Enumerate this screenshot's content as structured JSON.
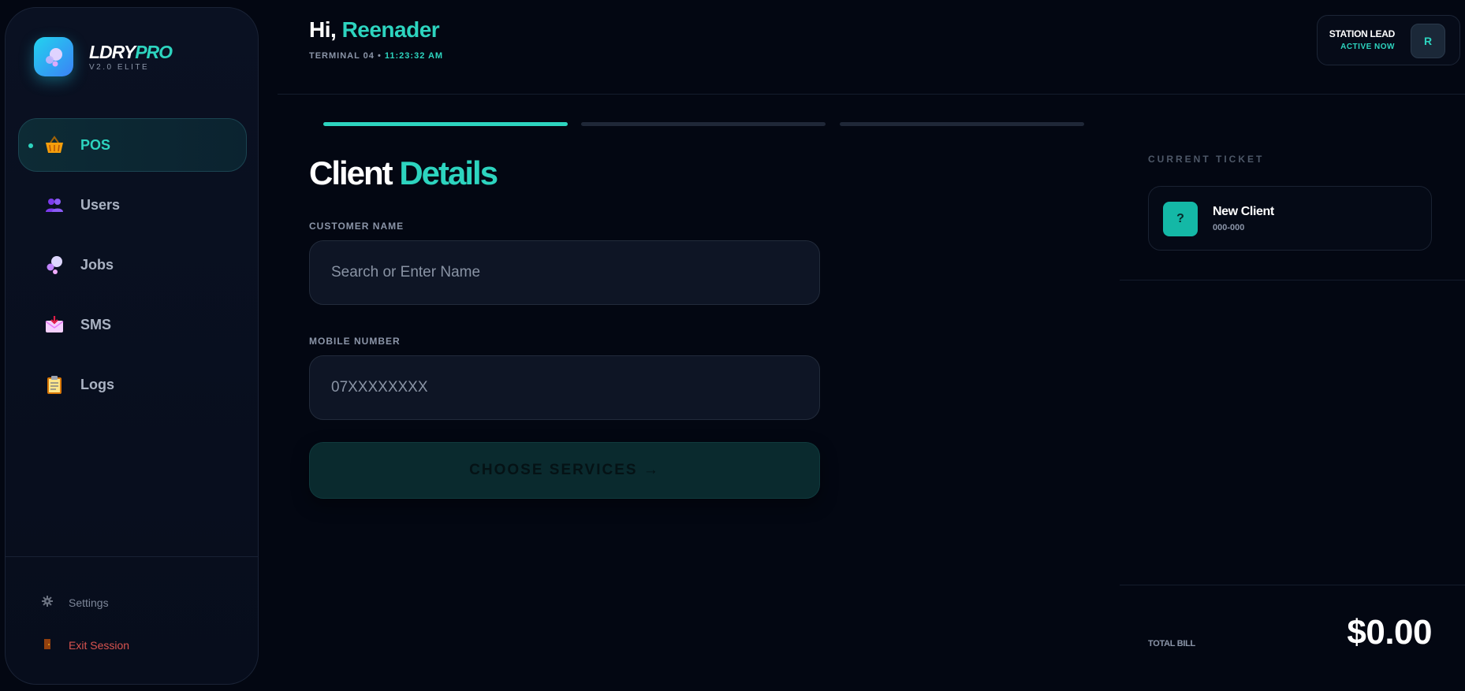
{
  "app": {
    "name_main": "LDRY",
    "name_accent": "PRO",
    "version": "V2.0 ELITE"
  },
  "sidebar": {
    "items": [
      {
        "label": "POS",
        "icon": "basket-icon",
        "active": true
      },
      {
        "label": "Users",
        "icon": "users-icon"
      },
      {
        "label": "Jobs",
        "icon": "bubbles-icon"
      },
      {
        "label": "SMS",
        "icon": "envelope-icon"
      },
      {
        "label": "Logs",
        "icon": "clipboard-icon"
      }
    ],
    "settings_label": "Settings",
    "exit_label": "Exit Session"
  },
  "header": {
    "greeting": "Hi,",
    "user_name": "Reenader",
    "terminal": "TERMINAL 04 •",
    "time": "11:23:32 AM",
    "role": "STATION LEAD",
    "status": "ACTIVE NOW",
    "avatar_initial": "R"
  },
  "steps": {
    "total": 3,
    "completed": 1
  },
  "form": {
    "title_main": "Client",
    "title_accent": "Details",
    "customer_label": "CUSTOMER NAME",
    "customer_placeholder": "Search or Enter Name",
    "mobile_label": "MOBILE NUMBER",
    "mobile_placeholder": "07XXXXXXXX",
    "cta_label": "CHOOSE SERVICES →"
  },
  "ticket": {
    "caption": "CURRENT TICKET",
    "badge": "?",
    "client_name": "New Client",
    "client_id": "000-000",
    "total_label": "TOTAL BILL",
    "total_value": "$0.00"
  },
  "colors": {
    "accent": "#2dd4bf",
    "background": "#030712",
    "danger": "#d9534f"
  }
}
